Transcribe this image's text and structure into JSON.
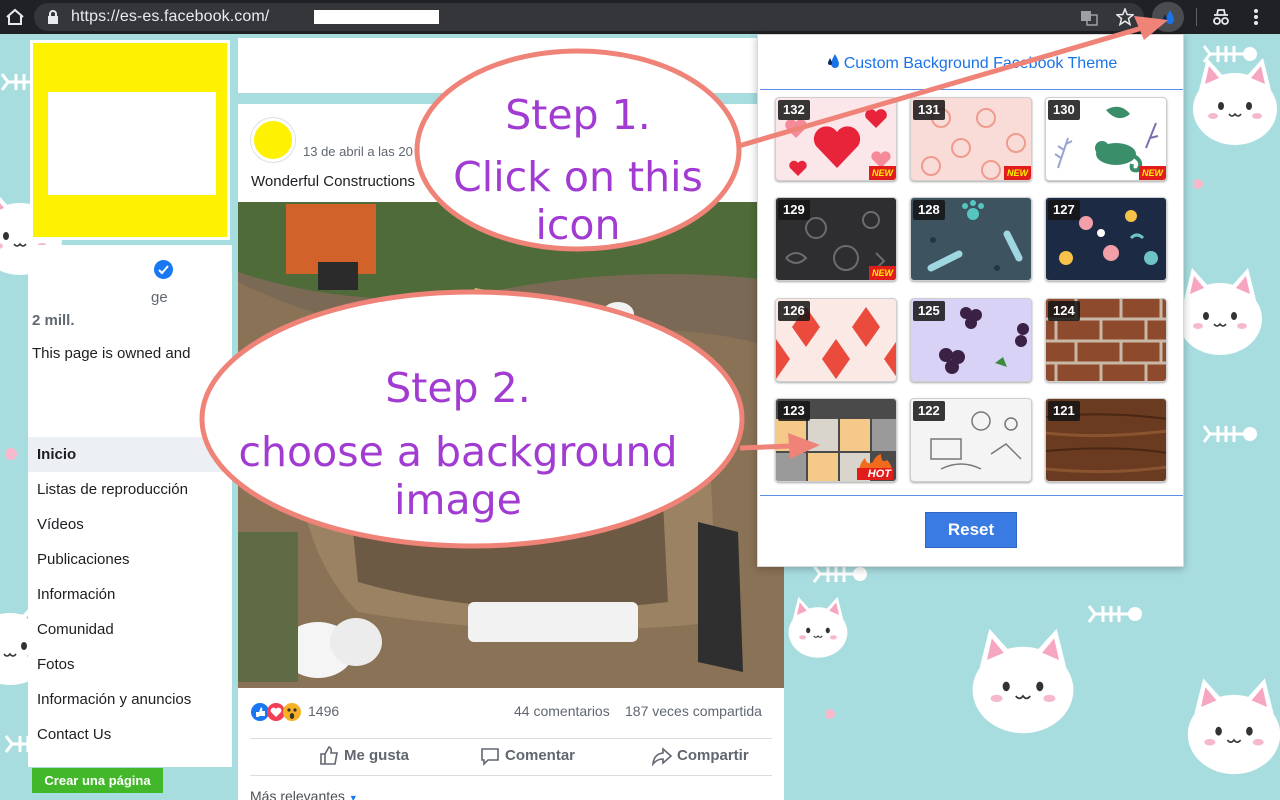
{
  "browser": {
    "url": "https://es-es.facebook.com/"
  },
  "left_column": {
    "page_label_fragment": "ge",
    "followers": "2 mill.",
    "owned_text": "This page is owned and",
    "nav": [
      {
        "label": "Inicio",
        "active": true
      },
      {
        "label": "Listas de reproducción"
      },
      {
        "label": "Vídeos"
      },
      {
        "label": "Publicaciones"
      },
      {
        "label": "Información"
      },
      {
        "label": "Comunidad"
      },
      {
        "label": "Fotos"
      },
      {
        "label": "Información y anuncios"
      },
      {
        "label": "Contact Us"
      }
    ],
    "create_page": "Crear una página"
  },
  "post": {
    "date": "13 de abril a las 20",
    "text": "Wonderful Constructions",
    "reactions_count": "1496",
    "comments": "44 comentarios",
    "shares": "187 veces compartida",
    "actions": {
      "like": "Me gusta",
      "comment": "Comentar",
      "share": "Compartir"
    },
    "sort": "Más relevantes"
  },
  "popup": {
    "title": "Custom Background Facebook Theme",
    "reset": "Reset",
    "themes": [
      {
        "id": "132",
        "badge": "NEW"
      },
      {
        "id": "131",
        "badge": "NEW"
      },
      {
        "id": "130",
        "badge": "NEW"
      },
      {
        "id": "129",
        "badge": "NEW"
      },
      {
        "id": "128",
        "badge": ""
      },
      {
        "id": "127",
        "badge": ""
      },
      {
        "id": "126",
        "badge": ""
      },
      {
        "id": "125",
        "badge": ""
      },
      {
        "id": "124",
        "badge": ""
      },
      {
        "id": "123",
        "badge": "HOT"
      },
      {
        "id": "122",
        "badge": ""
      },
      {
        "id": "121",
        "badge": ""
      }
    ]
  },
  "annotations": {
    "step1_title": "Step 1.",
    "step1_text": "Click on this icon",
    "step2_title": "Step 2.",
    "step2_text": "choose a background image"
  },
  "colors": {
    "annotation_text": "#a13bd1",
    "annotation_outline": "#f08378",
    "popup_accent": "#1a73e8",
    "reset_button": "#3a7be3",
    "page_background": "#a8dde0"
  }
}
